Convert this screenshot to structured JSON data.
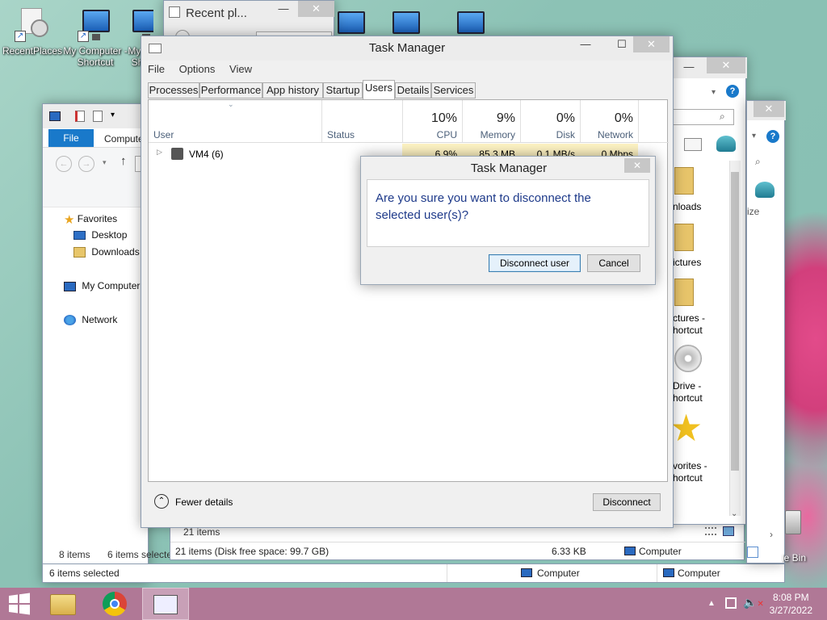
{
  "desktop_icons": [
    {
      "label": "RecentPlaces"
    },
    {
      "label": "My Computer - Shortcut"
    },
    {
      "label": "My - Sh"
    }
  ],
  "bg_window_recent": {
    "title": "Recent pl..."
  },
  "explorer_left": {
    "file_tab": "File",
    "computer_tab": "Compute",
    "favorites": "Favorites",
    "desktop": "Desktop",
    "downloads": "Downloads",
    "my_computer": "My Computer",
    "network": "Network",
    "status_items": "8 items",
    "status_selected": "6 items selecte",
    "status_bottom": "6 items selected"
  },
  "explorer_mid": {
    "items_count": "21 items",
    "status": "21 items (Disk free space: 99.7 GB)",
    "size": "6.33 KB",
    "computer": "Computer",
    "computer2": "Computer"
  },
  "explorer_right": {
    "labels": [
      "nloads",
      "ictures",
      "ctures -",
      "hortcut",
      "Drive -",
      "hortcut",
      "vorites -",
      "hortcut"
    ],
    "ize": "ize",
    "computer": "Computer",
    "recycle": "le Bin"
  },
  "task_manager": {
    "title": "Task Manager",
    "menu": [
      "File",
      "Options",
      "View"
    ],
    "tabs": [
      "Processes",
      "Performance",
      "App history",
      "Startup",
      "Users",
      "Details",
      "Services"
    ],
    "columns": {
      "user": "User",
      "status": "Status",
      "cpu_pct": "10%",
      "cpu": "CPU",
      "mem_pct": "9%",
      "mem": "Memory",
      "disk_pct": "0%",
      "disk": "Disk",
      "net_pct": "0%",
      "net": "Network"
    },
    "row": {
      "name": "VM4 (6)",
      "cpu": "6.9%",
      "mem": "85.3 MB",
      "disk": "0.1 MB/s",
      "net": "0 Mbps"
    },
    "fewer_details": "Fewer details",
    "disconnect": "Disconnect"
  },
  "dialog": {
    "title": "Task Manager",
    "message": "Are you sure you want to disconnect the selected user(s)?",
    "confirm": "Disconnect user",
    "cancel": "Cancel"
  },
  "clock": {
    "time": "8:08 PM",
    "date": "3/27/2022"
  }
}
